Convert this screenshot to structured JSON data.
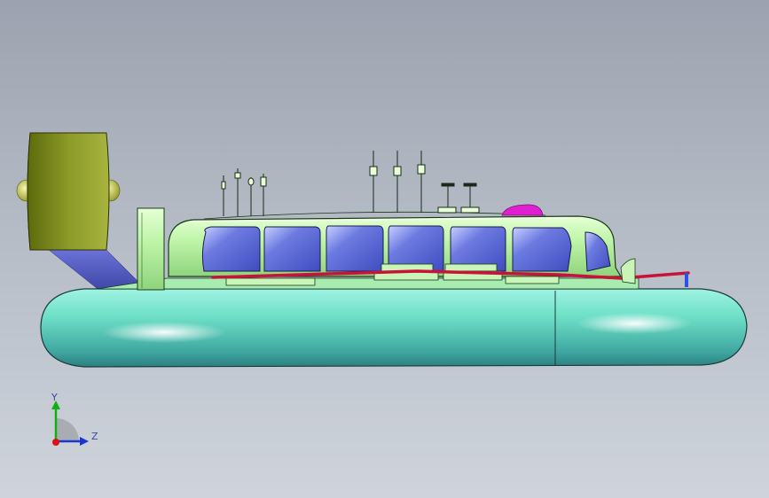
{
  "viewport": {
    "background_top": "#9aa3af",
    "background_bottom": "#cfd4dc"
  },
  "model": {
    "hull_color": "#6fe0c8",
    "cabin_color": "#bff5a8",
    "window_color": "#5a6ad8",
    "fan_color": "#7d8a1c",
    "rail_color": "#c8123a",
    "accent_color": "#e020d0"
  },
  "triad": {
    "y_label": "Y",
    "z_label": "Z",
    "y_color": "#10b010",
    "z_color": "#1a36d0",
    "x_color": "#e01010"
  }
}
